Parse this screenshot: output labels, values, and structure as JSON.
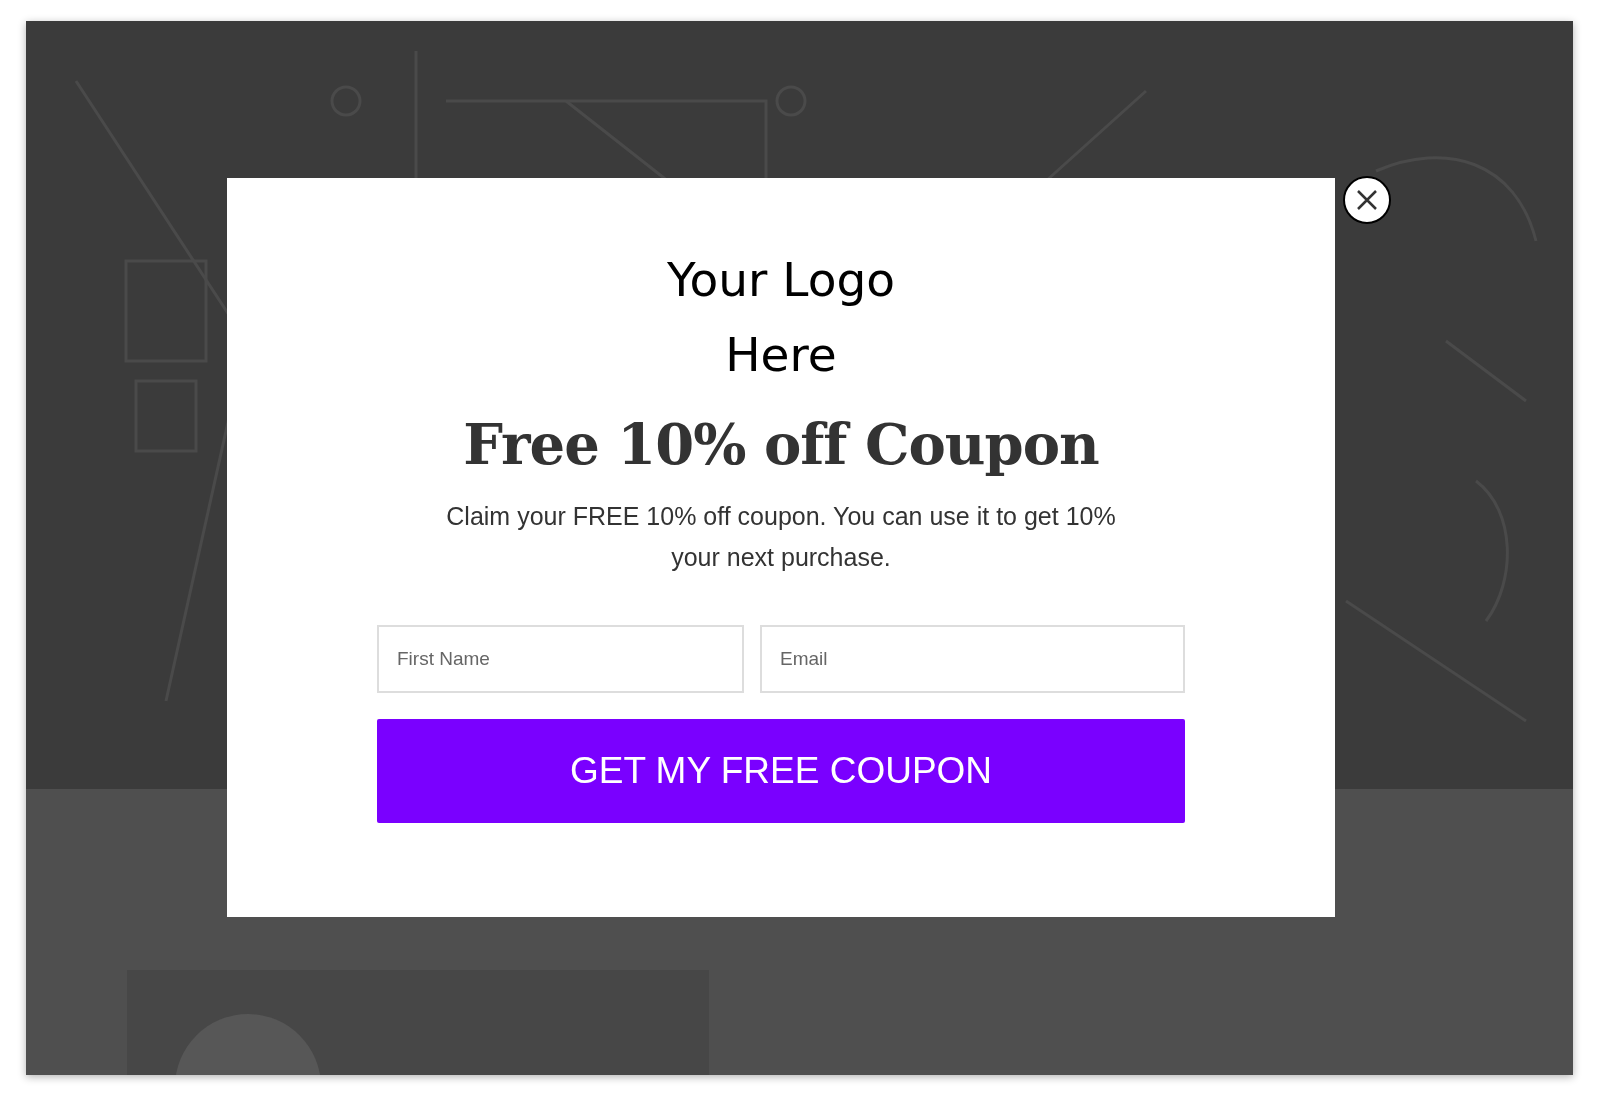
{
  "popup": {
    "logo_lines": [
      "Your Logo",
      "Here"
    ],
    "title": "Free 10% off Coupon",
    "description": "Claim your FREE 10% off coupon. You can use it to get 10% your next purchase.",
    "fields": [
      {
        "placeholder": "First Name"
      },
      {
        "placeholder": "Email"
      }
    ],
    "submit": "GET MY FREE COUPON"
  }
}
